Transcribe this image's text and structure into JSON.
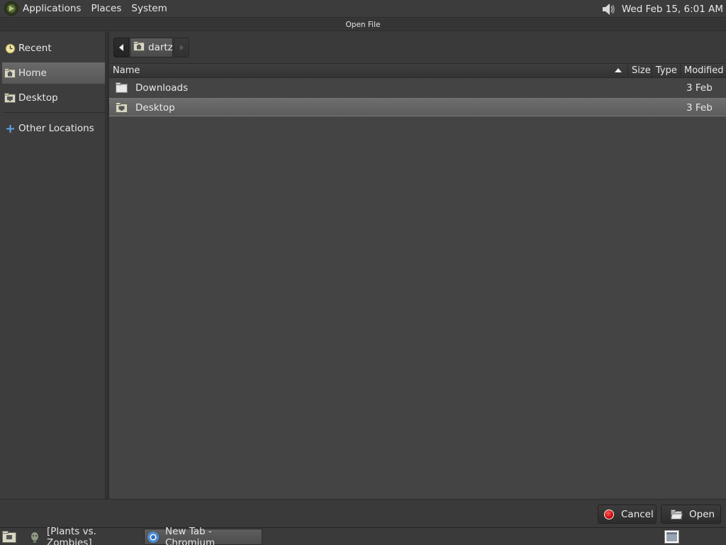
{
  "top_panel": {
    "menus": [
      "Applications",
      "Places",
      "System"
    ],
    "clock": "Wed Feb 15,  6:01 AM"
  },
  "dialog": {
    "title": "Open File"
  },
  "sidebar": {
    "items": [
      {
        "label": "Recent",
        "icon": "clock-icon"
      },
      {
        "label": "Home",
        "icon": "home-folder-icon",
        "selected": true
      },
      {
        "label": "Desktop",
        "icon": "desktop-folder-icon"
      },
      {
        "label": "Other Locations",
        "icon": "plus-icon"
      }
    ]
  },
  "pathbar": {
    "current": "dartz"
  },
  "file_list": {
    "columns": [
      "Name",
      "Size",
      "Type",
      "Modified"
    ],
    "sort": "ascending",
    "rows": [
      {
        "name": "Downloads",
        "modified": "3 Feb",
        "icon": "folder-icon",
        "selected": false
      },
      {
        "name": "Desktop",
        "modified": "3 Feb",
        "icon": "desktop-folder-icon",
        "selected": true
      }
    ]
  },
  "buttons": {
    "cancel": "Cancel",
    "open": "Open"
  },
  "taskbar": {
    "tasks": [
      "[Plants vs. Zombies]",
      "New Tab - Chromium"
    ]
  },
  "colors": {
    "background": "#444444",
    "selection": "#666666",
    "cancel_icon": "#d40000"
  }
}
